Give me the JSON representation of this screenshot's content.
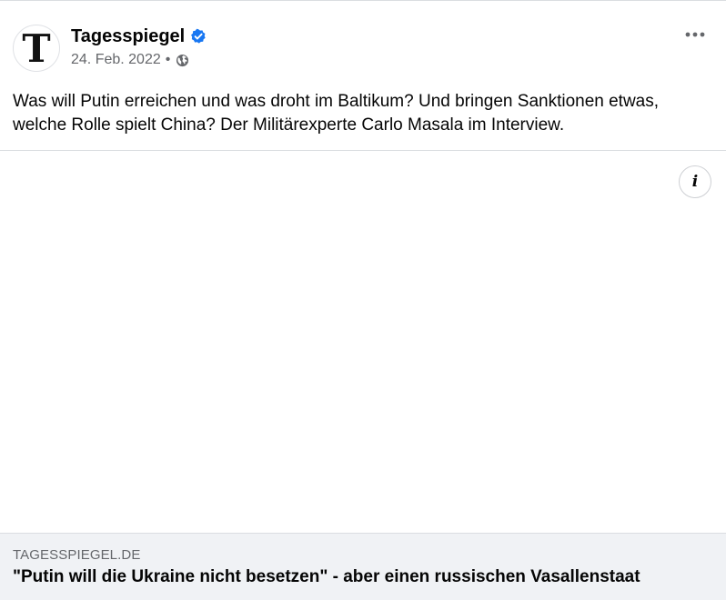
{
  "post": {
    "page_name": "Tagesspiegel",
    "avatar_letter": "T",
    "date": "24. Feb. 2022",
    "separator": "•",
    "audience_icon": "globe-icon",
    "verified_icon": "verified-badge-icon",
    "more_icon": "more-options-icon",
    "text": "Was will Putin erreichen und was droht im Baltikum? Und bringen Sanktionen etwas, welche Rolle spielt China? Der Militärexperte Carlo Masala im Interview."
  },
  "media": {
    "info_icon": "info-icon",
    "info_glyph": "i"
  },
  "link": {
    "domain": "TAGESSPIEGEL.DE",
    "title": "\"Putin will die Ukraine nicht besetzen\" - aber einen russischen Vasallenstaat"
  },
  "colors": {
    "verified": "#1877f2",
    "secondary_text": "#65676b",
    "footer_bg": "#f0f2f5",
    "divider": "#dadde1"
  }
}
